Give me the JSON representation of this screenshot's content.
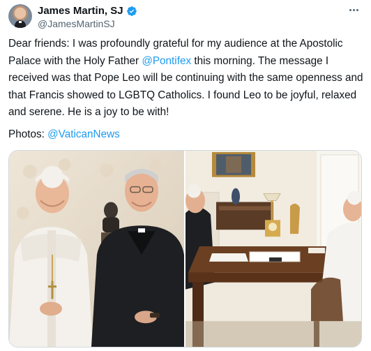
{
  "author": {
    "display_name": "James Martin, SJ",
    "handle": "@JamesMartinSJ",
    "verified": true,
    "verified_color": "#1d9bf0",
    "avatar_icon": "profile-avatar"
  },
  "tweet": {
    "text_parts": [
      "Dear friends: I was profoundly grateful for my audience at the Apostolic Palace with the Holy Father ",
      "@Pontifex",
      "  this morning. The message I received was that Pope Leo will be continuing with the same openness and that Francis showed to LGBTQ Catholics. I found Leo to be joyful, relaxed and serene.  He is a joy to be with!"
    ],
    "photos_label": "Photos: ",
    "photos_mention": "@VaticanNews",
    "mention_color": "#1d9bf0"
  },
  "menu": {
    "more_icon": "more-options-icon"
  },
  "media": {
    "count": 2,
    "photos": [
      {
        "icon": "photo-left"
      },
      {
        "icon": "photo-right"
      }
    ]
  }
}
